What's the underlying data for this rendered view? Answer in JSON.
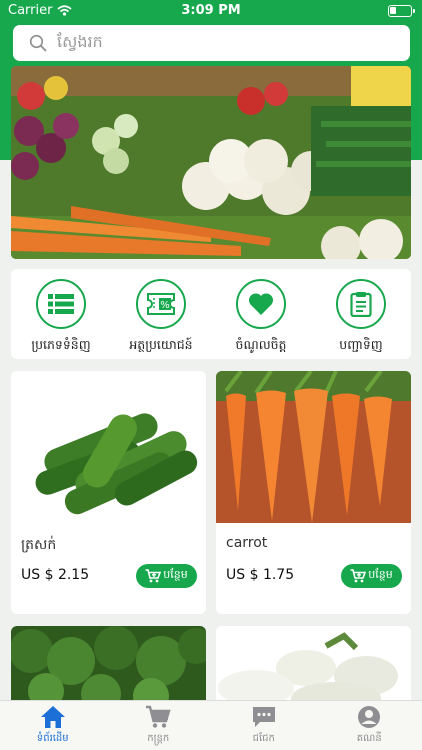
{
  "status_bar": {
    "carrier": "Carrier",
    "time": "3:09 PM"
  },
  "search": {
    "placeholder": "ស្វែងរក",
    "icon": "search-icon"
  },
  "banner": {
    "icon": "vegetable-market-photo"
  },
  "categories": [
    {
      "label": "ប្រភេទទំនិញ",
      "icon": "list-icon"
    },
    {
      "label": "អត្ថប្រយោជន៍",
      "icon": "percent-ticket-icon"
    },
    {
      "label": "ចំណូលចិត្ត",
      "icon": "heart-icon"
    },
    {
      "label": "បញ្ជាទិញ",
      "icon": "clipboard-icon"
    }
  ],
  "products": [
    {
      "name": "ត្រសក់",
      "price": "US $ 2.15",
      "add_label": "បន្ថែម",
      "image": "cucumber-photo"
    },
    {
      "name": "carrot",
      "price": "US $ 1.75",
      "add_label": "បន្ថែម",
      "image": "carrot-photo"
    },
    {
      "image": "broccoli-photo"
    },
    {
      "image": "eggplant-photo"
    }
  ],
  "tabs": [
    {
      "label": "ទំព័រដើម",
      "icon": "home-icon",
      "active": true
    },
    {
      "label": "កន្ត្រក",
      "icon": "cart-icon",
      "active": false
    },
    {
      "label": "ជជែក",
      "icon": "chat-icon",
      "active": false
    },
    {
      "label": "គណនី",
      "icon": "account-icon",
      "active": false
    }
  ],
  "colors": {
    "brand": "#17a84e",
    "active_tab": "#1d6fd8"
  }
}
